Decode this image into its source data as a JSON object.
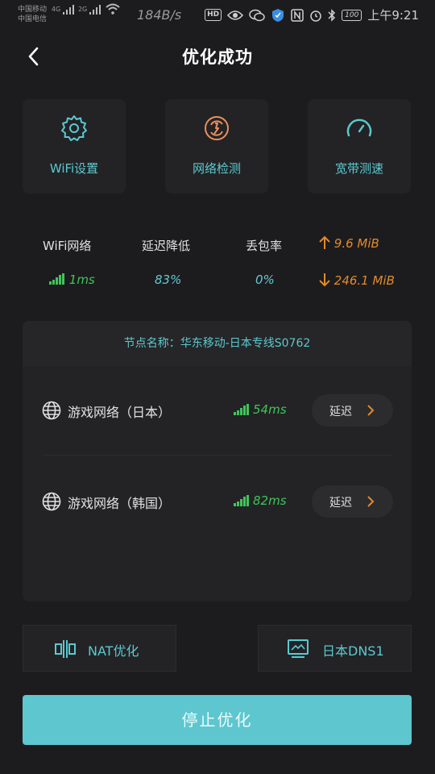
{
  "status_bar": {
    "carrier1": "中国移动",
    "carrier2": "中国电信",
    "net1": "4G",
    "net2": "2G",
    "speed": "184B/s",
    "hd": "HD",
    "battery": "100",
    "time": "上午9:21"
  },
  "header": {
    "title": "优化成功"
  },
  "tools": [
    {
      "label": "WiFi设置",
      "icon": "gear-icon"
    },
    {
      "label": "网络检测",
      "icon": "network-check-icon"
    },
    {
      "label": "宽带测速",
      "icon": "speedometer-icon"
    }
  ],
  "stats": {
    "wifi_label": "WiFi网络",
    "wifi_value": "1ms",
    "latency_label": "延迟降低",
    "latency_value": "83%",
    "loss_label": "丢包率",
    "loss_value": "0%",
    "upload": "9.6  MiB",
    "download": "246.1  MiB"
  },
  "node": {
    "name": "节点名称：华东移动-日本专线S0762",
    "rows": [
      {
        "label": "游戏网络（日本）",
        "ping": "54ms",
        "action": "延迟"
      },
      {
        "label": "游戏网络（韩国）",
        "ping": "82ms",
        "action": "延迟"
      }
    ]
  },
  "bottom": {
    "nat_label": "NAT优化",
    "dns_label": "日本DNS1",
    "stop_label": "停止优化"
  },
  "colors": {
    "accent": "#5bc9d0",
    "green": "#3fc55a",
    "orange": "#e08a2a",
    "background": "#1c1c1e",
    "card": "#232325",
    "button": "#5ec6ce"
  }
}
